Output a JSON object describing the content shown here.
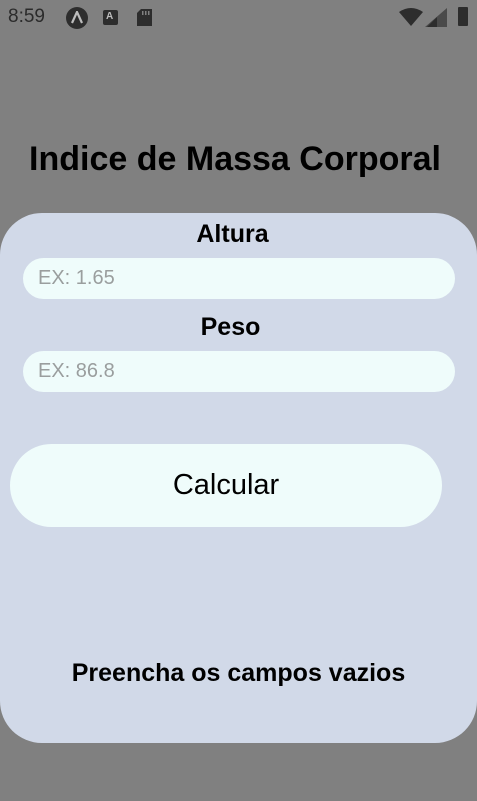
{
  "status_bar": {
    "time": "8:59",
    "icons": [
      "android-a-icon",
      "text-badge-icon",
      "sd-card-icon",
      "wifi-icon",
      "cell-signal-icon",
      "battery-icon"
    ],
    "text_badge": "A"
  },
  "title": "Indice de Massa Corporal",
  "form": {
    "altura_label": "Altura",
    "altura_placeholder": "EX: 1.65",
    "altura_value": "",
    "peso_label": "Peso",
    "peso_placeholder": "EX: 86.8",
    "peso_value": "",
    "calculate_label": "Calcular",
    "message": "Preencha os campos vazios"
  },
  "colors": {
    "backdrop": "#808080",
    "card": "#d1d9e8",
    "field": "#effcfb"
  }
}
